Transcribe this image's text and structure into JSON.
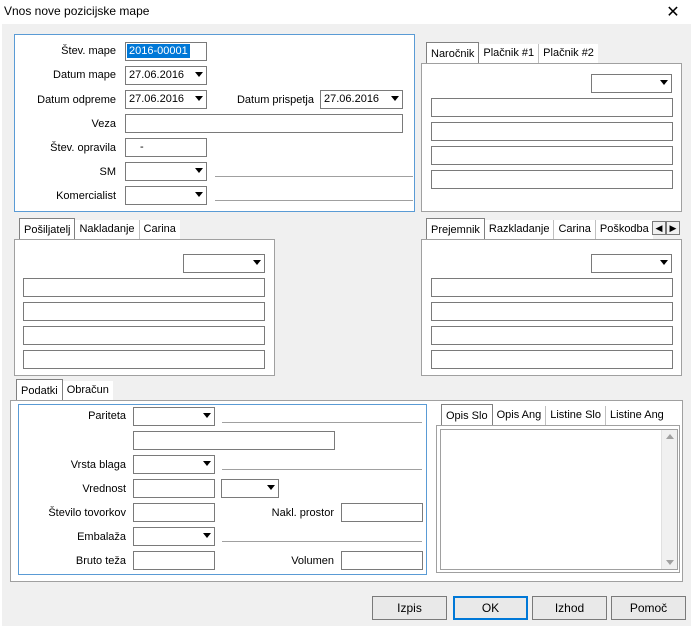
{
  "window": {
    "title": "Vnos nove pozicijske mape",
    "close_glyph": "✕"
  },
  "main": {
    "stev_mape_label": "Štev. mape",
    "stev_mape_value": "2016-00001",
    "datum_mape_label": "Datum mape",
    "datum_mape_value": "27.06.2016",
    "datum_odpreme_label": "Datum odpreme",
    "datum_odpreme_value": "27.06.2016",
    "datum_prispetja_label": "Datum prispetja",
    "datum_prispetja_value": "27.06.2016",
    "veza_label": "Veza",
    "veza_value": "",
    "stev_opravila_label": "Štev. opravila",
    "stev_opravila_value": "-",
    "sm_label": "SM",
    "komercialist_label": "Komercialist"
  },
  "narocnik": {
    "tabs": [
      "Naročnik",
      "Plačnik #1",
      "Plačnik #2"
    ]
  },
  "posiljatelj": {
    "tabs": [
      "Pošiljatelj",
      "Nakladanje",
      "Carina"
    ]
  },
  "prejemnik": {
    "tabs": [
      "Prejemnik",
      "Razkladanje",
      "Carina",
      "Poškodba"
    ]
  },
  "bottom": {
    "tabs": [
      "Podatki",
      "Obračun"
    ],
    "pariteta_label": "Pariteta",
    "vrsta_blaga_label": "Vrsta blaga",
    "vrednost_label": "Vrednost",
    "stevilo_tovorkov_label": "Število tovorkov",
    "nakl_prostor_label": "Nakl. prostor",
    "embalaza_label": "Embalaža",
    "bruto_teza_label": "Bruto teža",
    "volumen_label": "Volumen"
  },
  "opis": {
    "tabs": [
      "Opis Slo",
      "Opis Ang",
      "Listine Slo",
      "Listine Ang"
    ]
  },
  "buttons": {
    "izpis": "Izpis",
    "ok": "OK",
    "izhod": "Izhod",
    "pomoc": "Pomoč"
  }
}
